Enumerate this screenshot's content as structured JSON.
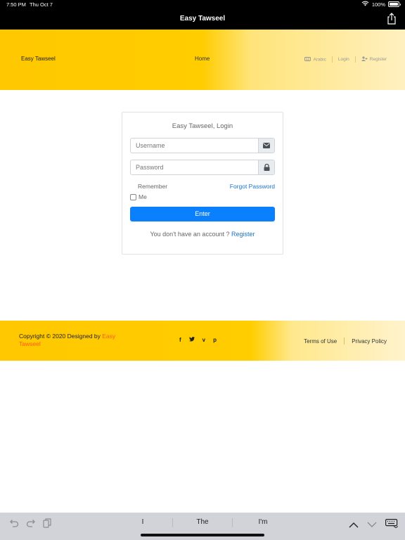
{
  "status_bar": {
    "time": "7:50 PM",
    "date": "Thu Oct 7",
    "battery": "100%",
    "battery_level": 1.0
  },
  "app": {
    "title": "Easy Tawseel"
  },
  "header": {
    "brand": "Easy Tawseel",
    "nav_home": "Home",
    "lang": "Arabic",
    "login": "Login",
    "register": "Register"
  },
  "login": {
    "title": "Easy Tawseel, Login",
    "username_placeholder": "Username",
    "password_placeholder": "Password",
    "remember": "Remember",
    "remember_me": "Me",
    "forgot": "Forgot Password",
    "enter": "Enter",
    "no_account": "You don't have an account ?",
    "register": "Register"
  },
  "footer": {
    "copyright": "Copyright © 2020 Designed by",
    "designer": "Easy Tawseel",
    "socials": [
      "f",
      "t",
      "v",
      "p"
    ],
    "terms": "Terms of Use",
    "privacy": "Privacy Policy"
  },
  "keyboard": {
    "suggestions": [
      "I",
      "The",
      "I'm"
    ]
  },
  "colors": {
    "accent": "#ffc800",
    "primary": "#0a80ff",
    "link": "#1a73c8",
    "designer": "#ff5a1f"
  },
  "icons": [
    "wifi-icon",
    "battery-icon",
    "share-icon",
    "language-icon",
    "user-plus-icon",
    "envelope-icon",
    "lock-icon",
    "facebook-icon",
    "twitter-icon",
    "vimeo-icon",
    "pinterest-icon",
    "undo-icon",
    "redo-icon",
    "paste-icon",
    "chevron-up-icon",
    "chevron-down-icon",
    "keyboard-icon"
  ]
}
